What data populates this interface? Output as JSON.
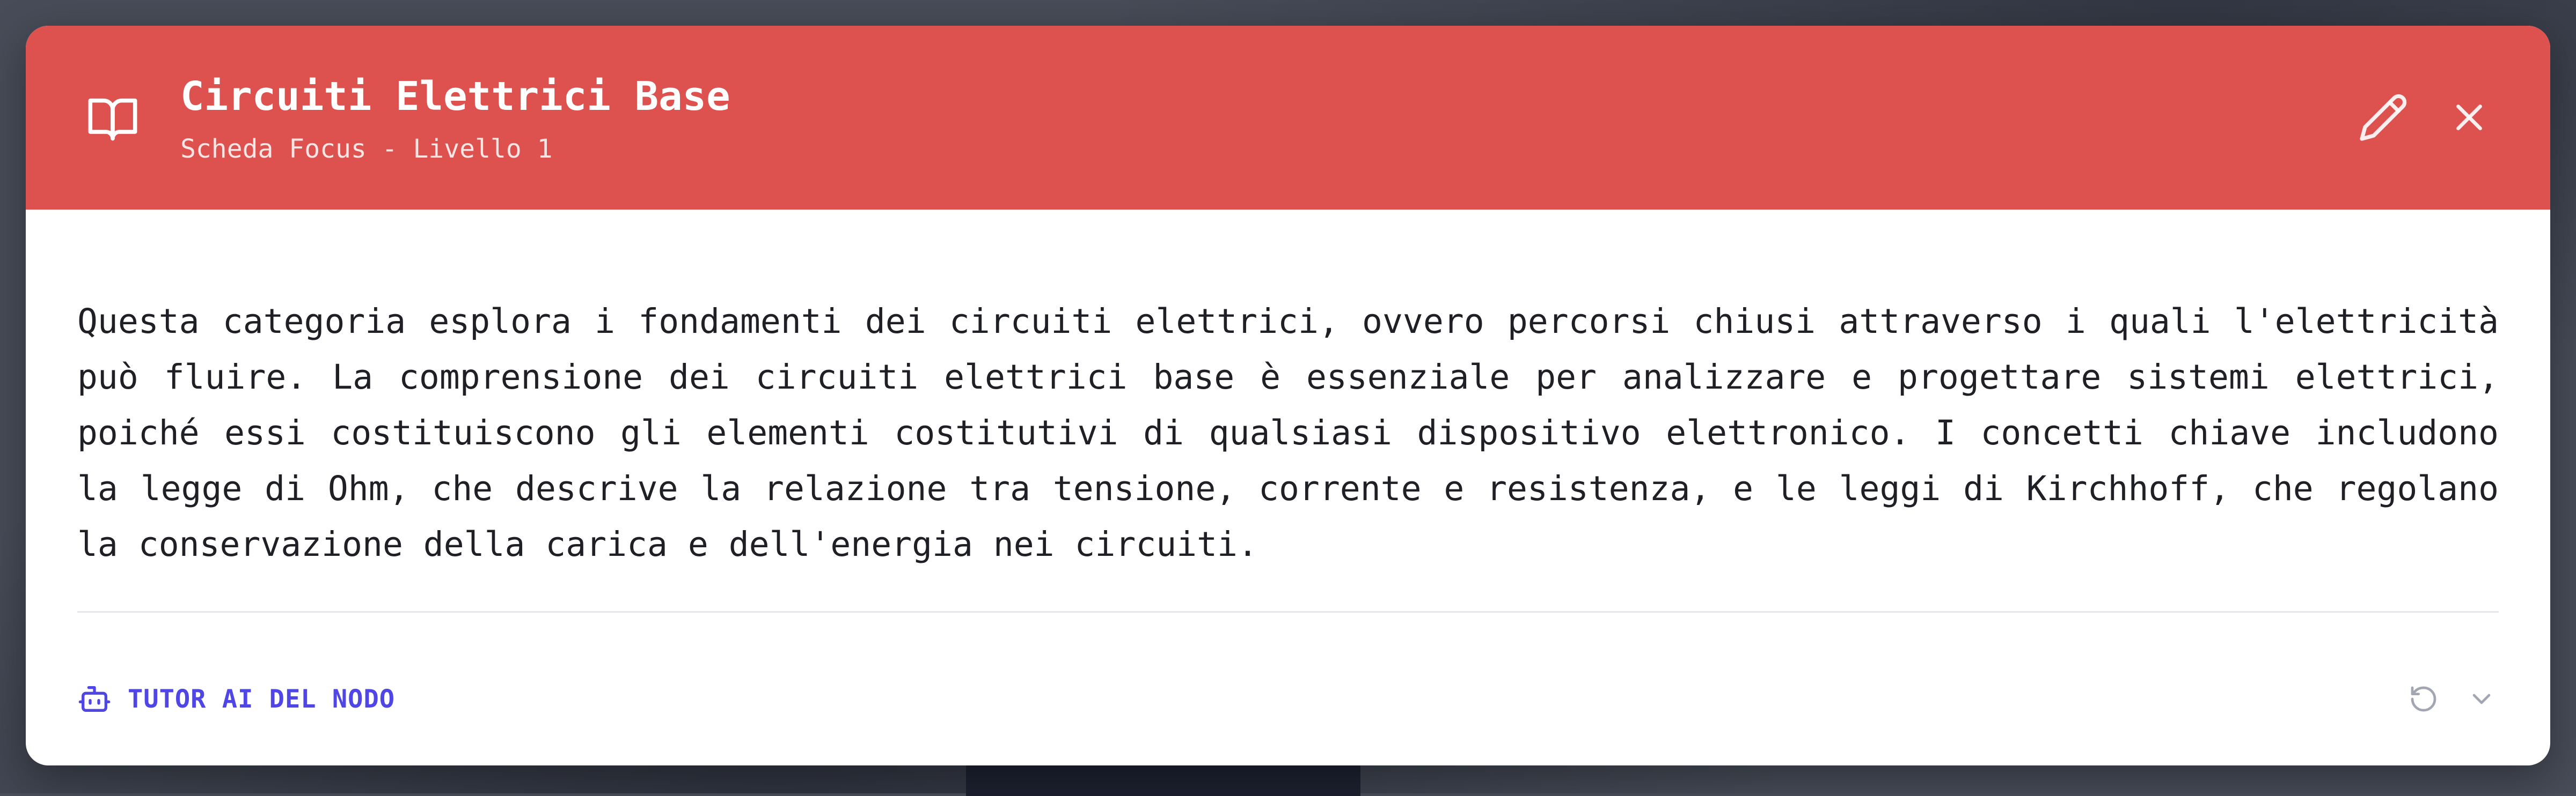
{
  "colors": {
    "header_bg": "#dd524f",
    "accent": "#4f46e5",
    "text": "#1f1f26",
    "muted_icon": "#a2a6b2"
  },
  "header": {
    "icon": "book-open-icon",
    "title": "Circuiti Elettrici Base",
    "subtitle": "Scheda Focus - Livello 1",
    "actions": [
      "pencil-icon",
      "close-icon"
    ]
  },
  "content": {
    "description": "Questa categoria esplora i fondamenti dei circuiti elettrici, ovvero percorsi chiusi attraverso i quali l'elettricità può fluire. La comprensione dei circuiti elettrici base è essenziale per analizzare e progettare sistemi elettrici, poiché essi costituiscono gli elementi costitutivi di qualsiasi dispositivo elettronico. I concetti chiave includono la legge di Ohm, che descrive la relazione tra tensione, corrente e resistenza, e le leggi di Kirchhoff, che regolano la conservazione della carica e dell'energia nei circuiti."
  },
  "footer": {
    "tutor_icon": "robot-icon",
    "tutor_label": "TUTOR AI DEL NODO",
    "actions": [
      "refresh-icon",
      "chevron-down-icon"
    ]
  }
}
